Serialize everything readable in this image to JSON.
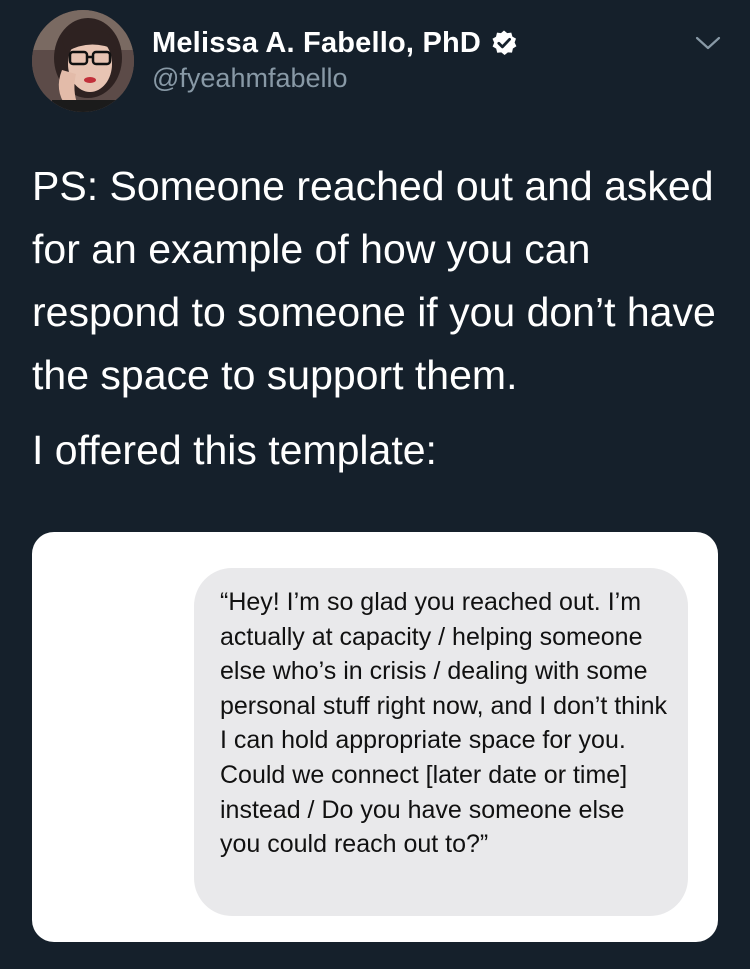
{
  "tweet": {
    "author": {
      "display_name": "Melissa A. Fabello, PhD",
      "handle": "@fyeahmfabello",
      "verified": true
    },
    "text_paragraphs": [
      "PS: Someone reached out and asked for an example of how you can respond to someone if you don’t have the space to support them.",
      "I offered this template:"
    ],
    "media": {
      "message_bubble_text": "“Hey! I’m so glad you reached out. I’m actually at capacity / helping someone else who’s in crisis / dealing with some personal stuff right now, and I don’t think I can hold appropriate space for you. Could we connect [later date or time] instead / Do you have someone else you could reach out to?”"
    }
  },
  "icons": {
    "verified": "verified-badge-icon",
    "menu": "chevron-down-icon"
  },
  "colors": {
    "background": "#15202b",
    "secondary_text": "#8899a6",
    "bubble_gray": "#e9e9eb"
  }
}
